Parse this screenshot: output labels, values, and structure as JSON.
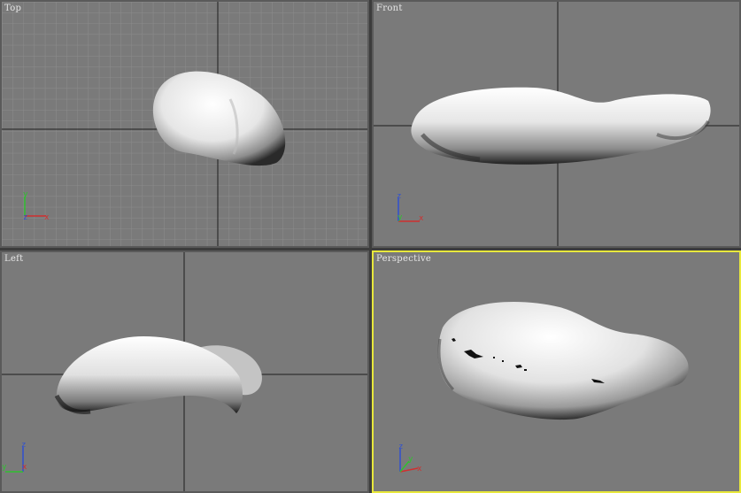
{
  "viewports": {
    "top": {
      "label": "Top",
      "axes": {
        "vertical": "y",
        "horizontal": "x",
        "depth": "z"
      }
    },
    "front": {
      "label": "Front",
      "axes": {
        "vertical": "z",
        "horizontal": "x",
        "depth": "y"
      }
    },
    "left": {
      "label": "Left",
      "axes": {
        "vertical": "z",
        "horizontal": "y",
        "depth": "x"
      }
    },
    "perspective": {
      "label": "Perspective",
      "axes": {
        "vertical": "z",
        "horizontal": "x",
        "depth": "y"
      }
    }
  },
  "colors": {
    "viewport_bg": "#7a7a7a",
    "grid_line": "#8a8a8a",
    "world_axis": "#222222",
    "active_border": "#e8e83c",
    "axis_x": "#d03030",
    "axis_y": "#30c030",
    "axis_z": "#3050d0"
  },
  "active_viewport": "perspective"
}
